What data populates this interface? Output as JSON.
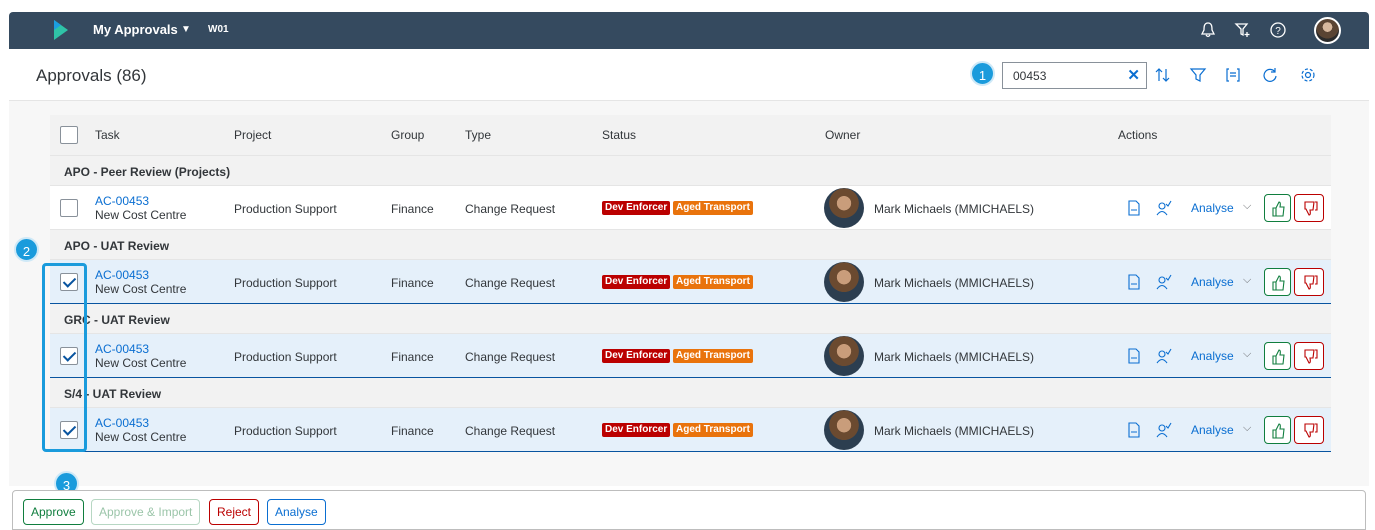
{
  "shell": {
    "app_title": "My Approvals",
    "system": "W01",
    "icons": [
      "bell-icon",
      "filter-plus-icon",
      "help-icon",
      "user-avatar"
    ]
  },
  "header": {
    "title": "Approvals (86)",
    "search_value": "00453",
    "clear_icon": "✕",
    "icons": [
      "sort-icon",
      "filter-icon",
      "group-icon",
      "refresh-icon",
      "settings-icon"
    ]
  },
  "markers": [
    "1",
    "2",
    "3"
  ],
  "table": {
    "columns": {
      "task": "Task",
      "project": "Project",
      "group": "Group",
      "type": "Type",
      "status": "Status",
      "owner": "Owner",
      "actions": "Actions"
    },
    "groups": [
      {
        "name": "APO - Peer Review (Projects)",
        "item": {
          "id": "AC-00453",
          "desc": "New Cost Centre",
          "project": "Production Support",
          "group": "Finance",
          "type": "Change Request",
          "status": [
            "Dev Enforcer",
            "Aged Transport"
          ],
          "owner": "Mark Michaels (MMICHAELS)",
          "analyse": "Analyse",
          "selected": false
        }
      },
      {
        "name": "APO - UAT Review",
        "item": {
          "id": "AC-00453",
          "desc": "New Cost Centre",
          "project": "Production Support",
          "group": "Finance",
          "type": "Change Request",
          "status": [
            "Dev Enforcer",
            "Aged Transport"
          ],
          "owner": "Mark Michaels (MMICHAELS)",
          "analyse": "Analyse",
          "selected": true
        }
      },
      {
        "name": "GRC - UAT Review",
        "item": {
          "id": "AC-00453",
          "desc": "New Cost Centre",
          "project": "Production Support",
          "group": "Finance",
          "type": "Change Request",
          "status": [
            "Dev Enforcer",
            "Aged Transport"
          ],
          "owner": "Mark Michaels (MMICHAELS)",
          "analyse": "Analyse",
          "selected": true
        }
      },
      {
        "name": "S/4 - UAT Review",
        "item": {
          "id": "AC-00453",
          "desc": "New Cost Centre",
          "project": "Production Support",
          "group": "Finance",
          "type": "Change Request",
          "status": [
            "Dev Enforcer",
            "Aged Transport"
          ],
          "owner": "Mark Michaels (MMICHAELS)",
          "analyse": "Analyse",
          "selected": true
        }
      }
    ]
  },
  "footer": {
    "approve": "Approve",
    "approve_import": "Approve & Import",
    "reject": "Reject",
    "analyse": "Analyse"
  },
  "colors": {
    "shell": "#354a5f",
    "accent": "#0a6ed1",
    "marker": "#1a9bdc",
    "positive": "#107e3e",
    "negative": "#bb0000",
    "warning": "#e9730c"
  }
}
